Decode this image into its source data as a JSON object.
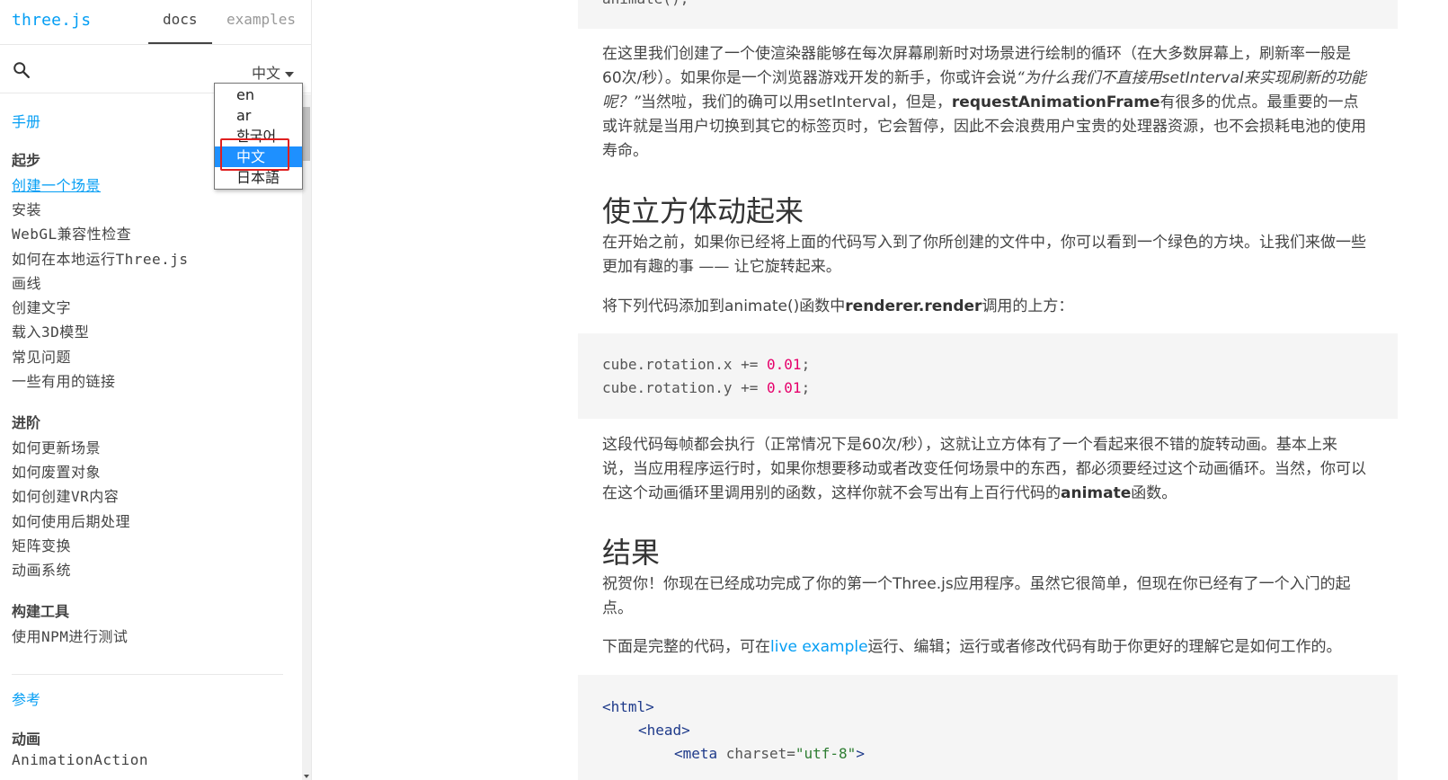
{
  "sidebar": {
    "logo": "three.js",
    "tabs": {
      "docs": "docs",
      "examples": "examples"
    },
    "language": {
      "current": "中文",
      "options": [
        "en",
        "ar",
        "한국어",
        "中文",
        "日本語"
      ],
      "selected_index": 3
    },
    "manual_title": "手册",
    "categories": [
      {
        "title": "起步",
        "items": [
          "创建一个场景",
          "安装",
          "WebGL兼容性检查",
          "如何在本地运行Three.js",
          "画线",
          "创建文字",
          "载入3D模型",
          "常见问题",
          "一些有用的链接"
        ]
      },
      {
        "title": "进阶",
        "items": [
          "如何更新场景",
          "如何废置对象",
          "如何创建VR内容",
          "如何使用后期处理",
          "矩阵变换",
          "动画系统"
        ]
      },
      {
        "title": "构建工具",
        "items": [
          "使用NPM进行测试"
        ]
      }
    ],
    "reference_title": "参考",
    "reference_cat": "动画",
    "reference_first_item": "AnimationAction"
  },
  "content": {
    "code_top": "animate();",
    "para1": {
      "t1": "在这里我们创建了一个使渲染器能够在每次屏幕刷新时对场景进行绘制的循环（在大多数屏幕上，刷新率一般是60次/秒）。如果你是一个浏览器游戏开发的新手，你或许会说",
      "t2": "“为什么我们不直接用setInterval来实现刷新的功能呢？”",
      "t3": "当然啦，我们的确可以用setInterval，但是，",
      "t4": "requestAnimationFrame",
      "t5": "有很多的优点。最重要的一点或许就是当用户切换到其它的标签页时，它会暂停，因此不会浪费用户宝贵的处理器资源，也不会损耗电池的使用寿命。"
    },
    "h2_rotate": "使立方体动起来",
    "para2": "在开始之前，如果你已经将上面的代码写入到了你所创建的文件中，你可以看到一个绿色的方块。让我们来做一些更加有趣的事 —— 让它旋转起来。",
    "para3": {
      "t1": "将下列代码添加到animate()函数中",
      "t2": "renderer.render",
      "t3": "调用的上方："
    },
    "code_rotate": [
      {
        "pre": "cube.rotation.x += ",
        "num": "0.01",
        "post": ";"
      },
      {
        "pre": "cube.rotation.y += ",
        "num": "0.01",
        "post": ";"
      }
    ],
    "para4": {
      "t1": "这段代码每帧都会执行（正常情况下是60次/秒），这就让立方体有了一个看起来很不错的旋转动画。基本上来说，当应用程序运行时，如果你想要移动或者改变任何场景中的东西，都必须要经过这个动画循环。当然，你可以在这个动画循环里调用别的函数，这样你就不会写出有上百行代码的",
      "t2": "animate",
      "t3": "函数。"
    },
    "h2_result": "结果",
    "para5": "祝贺你！你现在已经成功完成了你的第一个Three.js应用程序。虽然它很简单，但现在你已经有了一个入门的起点。",
    "para6": {
      "t1": "下面是完整的代码，可在",
      "link": "live example",
      "t2": "运行、编辑；运行或者修改代码有助于你更好的理解它是如何工作的。"
    },
    "code_full": {
      "l1": "<html>",
      "l2": "<head>",
      "l3_tag": "<meta ",
      "l3_attr": "charset",
      "l3_eq": "=",
      "l3_str": "\"utf-8\"",
      "l3_end": ">"
    }
  }
}
